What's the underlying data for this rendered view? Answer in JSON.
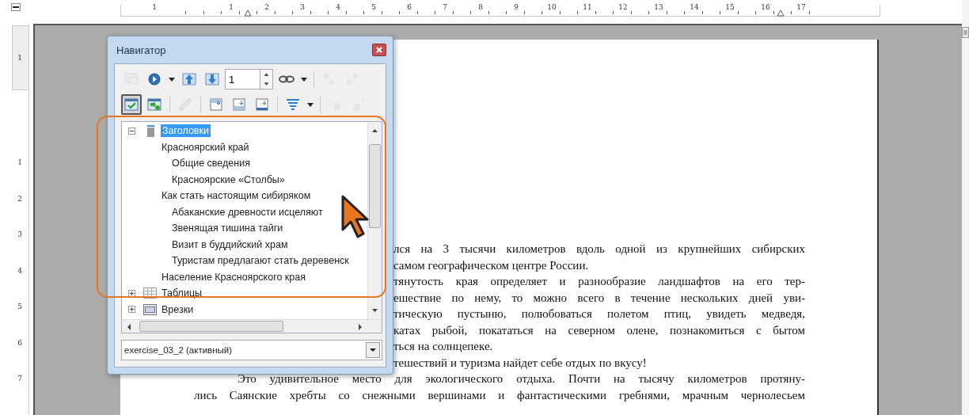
{
  "top_ruler": {
    "labels": [
      "1",
      "1",
      "2",
      "3",
      "4",
      "5",
      "6",
      "7",
      "8",
      "9",
      "10",
      "11",
      "12",
      "13",
      "14",
      "15",
      "16",
      "17"
    ]
  },
  "left_ruler": {
    "labels": [
      "1",
      "1",
      "2",
      "3",
      "4",
      "5",
      "6",
      "7"
    ]
  },
  "document": {
    "lines": [
      {
        "text": "лся на 3 тысячи километров вдоль одной из крупнейших сибирских",
        "kind": "covered",
        "paragraph_end": false
      },
      {
        "text": "самом географическом центре России.",
        "kind": "covered",
        "paragraph_end": true
      },
      {
        "text": "тянутость края определяет и разнообразие ландшафтов на его тер-",
        "kind": "covered",
        "paragraph_end": false
      },
      {
        "text": "ешествие по нему, то можно всего в течение нескольких дней уви-",
        "kind": "covered",
        "paragraph_end": false
      },
      {
        "text": "тическую пустыню, полюбоваться полетом птиц, увидеть медведя,",
        "kind": "covered",
        "paragraph_end": false
      },
      {
        "text": "катах рыбой, покататься на северном олене, познакомиться с бытом",
        "kind": "covered",
        "paragraph_end": false
      },
      {
        "text": "ться на солнцепеке.",
        "kind": "covered",
        "paragraph_end": true
      },
      {
        "text": "тешествий и туризма найдет себе отдых по вкусу!",
        "kind": "covered",
        "paragraph_end": true
      },
      {
        "text": "Это удивительное место для экологического отдыха. Почти на тысячу километров протяну-",
        "kind": "first",
        "paragraph_end": false
      },
      {
        "text": "лись Саянские хребты со снежными вершинами и фантастическими гребнями, мрачным чернолесьем",
        "kind": "body",
        "paragraph_end": false
      }
    ]
  },
  "navigator": {
    "title": "Навигатор",
    "toolbar_rows": [
      [
        {
          "kind": "toggle-view",
          "pressed": false,
          "disabled": true
        },
        {
          "kind": "navigation",
          "pressed": false,
          "disabled": false
        },
        {
          "kind": "caret"
        },
        {
          "kind": "previous",
          "pressed": false,
          "disabled": false
        },
        {
          "kind": "next",
          "pressed": false,
          "disabled": false
        },
        {
          "kind": "page-field",
          "value": "1"
        },
        {
          "kind": "drag-mode",
          "pressed": false,
          "disabled": false
        },
        {
          "kind": "caret"
        },
        {
          "kind": "separator"
        },
        {
          "kind": "level-up",
          "pressed": false,
          "disabled": true
        },
        {
          "kind": "level-down",
          "pressed": false,
          "disabled": true
        }
      ],
      [
        {
          "kind": "content-view",
          "pressed": true,
          "disabled": false
        },
        {
          "kind": "reminder",
          "pressed": false,
          "disabled": false
        },
        {
          "kind": "separator"
        },
        {
          "kind": "link",
          "pressed": false,
          "disabled": true
        },
        {
          "kind": "separator"
        },
        {
          "kind": "header",
          "pressed": false,
          "disabled": false
        },
        {
          "kind": "footer",
          "pressed": false,
          "disabled": false
        },
        {
          "kind": "anchor",
          "pressed": false,
          "disabled": false
        },
        {
          "kind": "separator"
        },
        {
          "kind": "heading-levels",
          "pressed": false,
          "disabled": false
        },
        {
          "kind": "caret"
        },
        {
          "kind": "separator"
        },
        {
          "kind": "chapter-up",
          "pressed": false,
          "disabled": true
        },
        {
          "kind": "chapter-down",
          "pressed": false,
          "disabled": true
        }
      ]
    ],
    "tree": [
      {
        "label": "Заголовки",
        "kind": "headings",
        "expanded": true,
        "selected": true,
        "children": [
          {
            "label": "Красноярский край",
            "selected": false,
            "children": [
              {
                "label": "Общие сведения",
                "selected": false
              },
              {
                "label": "Красноярские «Столбы»",
                "selected": false
              }
            ]
          },
          {
            "label": "Как стать настоящим сибиряком",
            "selected": false,
            "children": [
              {
                "label": "Абаканские древности исцеляют",
                "selected": false
              },
              {
                "label": "Звенящая тишина тайги",
                "selected": false
              },
              {
                "label": "Визит в буддийский храм",
                "selected": false
              },
              {
                "label": "Туристам предлагают стать деревенск",
                "selected": false
              }
            ]
          },
          {
            "label": "Население Красноярского края",
            "selected": false
          }
        ]
      },
      {
        "label": "Таблицы",
        "kind": "tables",
        "expanded": false,
        "selected": false
      },
      {
        "label": "Врезки",
        "kind": "frames",
        "expanded": false,
        "selected": false
      }
    ],
    "document_select": {
      "value": "exercise_03_2 (активный)"
    }
  }
}
